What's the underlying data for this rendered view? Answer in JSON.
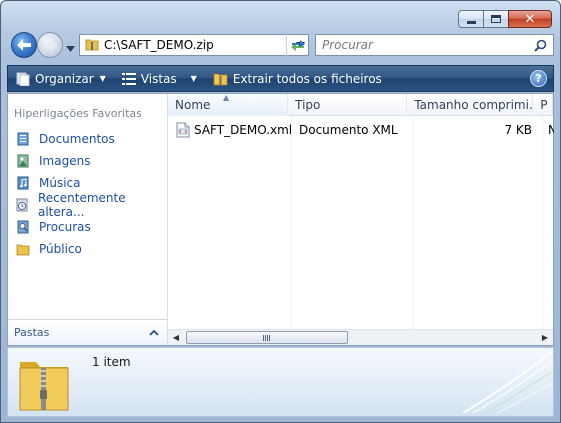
{
  "window": {
    "caption_buttons": [
      {
        "name": "minimize-button",
        "icon": "minimize-icon"
      },
      {
        "name": "maximize-button",
        "icon": "maximize-icon"
      },
      {
        "name": "close-button",
        "icon": "close-icon"
      }
    ]
  },
  "nav": {
    "address": "C:\\SAFT_DEMO.zip",
    "search_placeholder": "Procurar"
  },
  "toolbar": {
    "organize_label": "Organizar",
    "views_label": "Vistas",
    "extract_label": "Extrair todos os ficheiros",
    "help_label": "?"
  },
  "navpane": {
    "heading": "Hiperligações Favoritas",
    "items": [
      {
        "label": "Documentos",
        "icon": "documents-icon"
      },
      {
        "label": "Imagens",
        "icon": "pictures-icon"
      },
      {
        "label": "Música",
        "icon": "music-icon"
      },
      {
        "label": "Recentemente altera...",
        "icon": "recent-icon"
      },
      {
        "label": "Procuras",
        "icon": "searches-icon"
      },
      {
        "label": "Público",
        "icon": "public-folder-icon"
      }
    ],
    "folders_label": "Pastas"
  },
  "files": {
    "columns": [
      "Nome",
      "Tipo",
      "Tamanho comprimi...",
      "P"
    ],
    "rows": [
      {
        "name": "SAFT_DEMO.xml",
        "type": "Documento XML",
        "size": "7 KB",
        "extra": "N"
      }
    ]
  },
  "details": {
    "count": "1 item"
  },
  "colors": {
    "command_bar": "#2f5584",
    "link": "#1c4fa3",
    "close_button": "#c13f25"
  }
}
